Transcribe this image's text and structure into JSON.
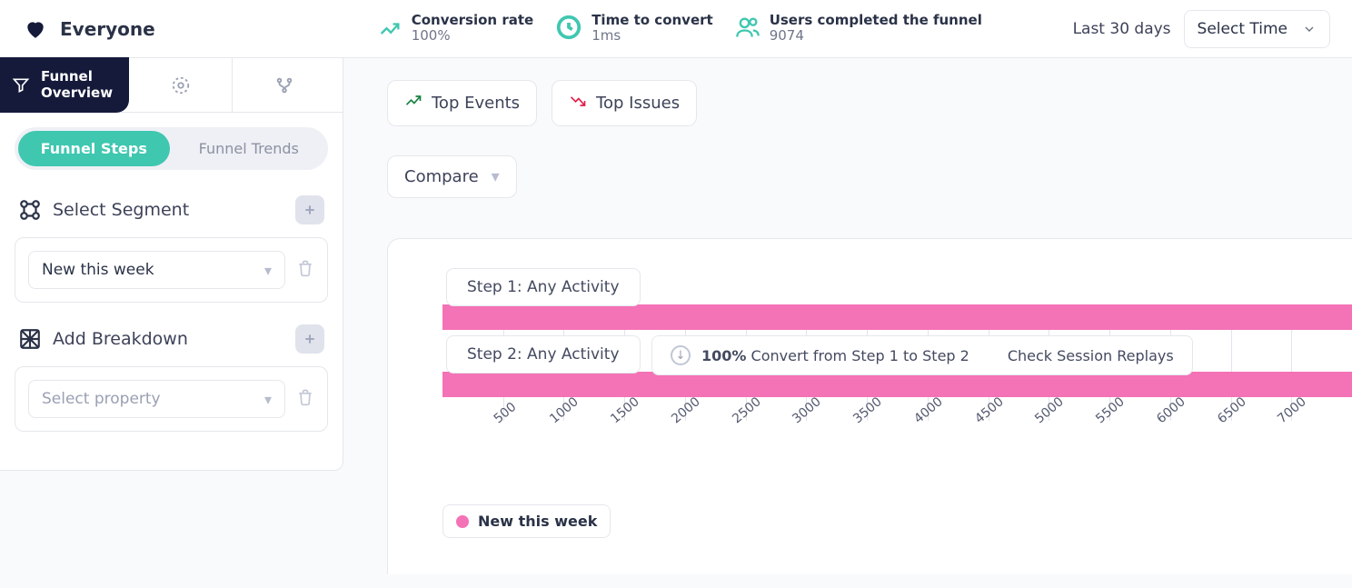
{
  "header": {
    "brand": "Everyone",
    "metrics": {
      "conversion": {
        "label": "Conversion rate",
        "value": "100%"
      },
      "time": {
        "label": "Time to convert",
        "value": "1ms"
      },
      "users": {
        "label": "Users completed the funnel",
        "value": "9074"
      }
    },
    "time_label": "Last 30 days",
    "time_select": "Select Time"
  },
  "sidebar": {
    "tab_main_line1": "Funnel",
    "tab_main_line2": "Overview",
    "pill_active": "Funnel Steps",
    "pill_inactive": "Funnel Trends",
    "segment_label": "Select Segment",
    "segment_value": "New this week",
    "breakdown_label": "Add Breakdown",
    "breakdown_placeholder": "Select property"
  },
  "main": {
    "top_events": "Top Events",
    "top_issues": "Top Issues",
    "compare": "Compare",
    "convert_pct": "100%",
    "convert_text": "Convert from Step 1 to Step 2",
    "replay_link": "Check Session Replays",
    "legend": "New this week"
  },
  "chart_data": {
    "type": "bar",
    "orientation": "horizontal",
    "xlabel": "",
    "ylabel": "",
    "xlim": [
      0,
      7500
    ],
    "categories": [
      "Step 1: Any Activity",
      "Step 2: Any Activity"
    ],
    "values": [
      9074,
      9074
    ],
    "axis_ticks": [
      500,
      1000,
      1500,
      2000,
      2500,
      3000,
      3500,
      4000,
      4500,
      5000,
      5500,
      6000,
      6500,
      7000
    ],
    "series_name": "New this week",
    "color": "#f472b6"
  }
}
